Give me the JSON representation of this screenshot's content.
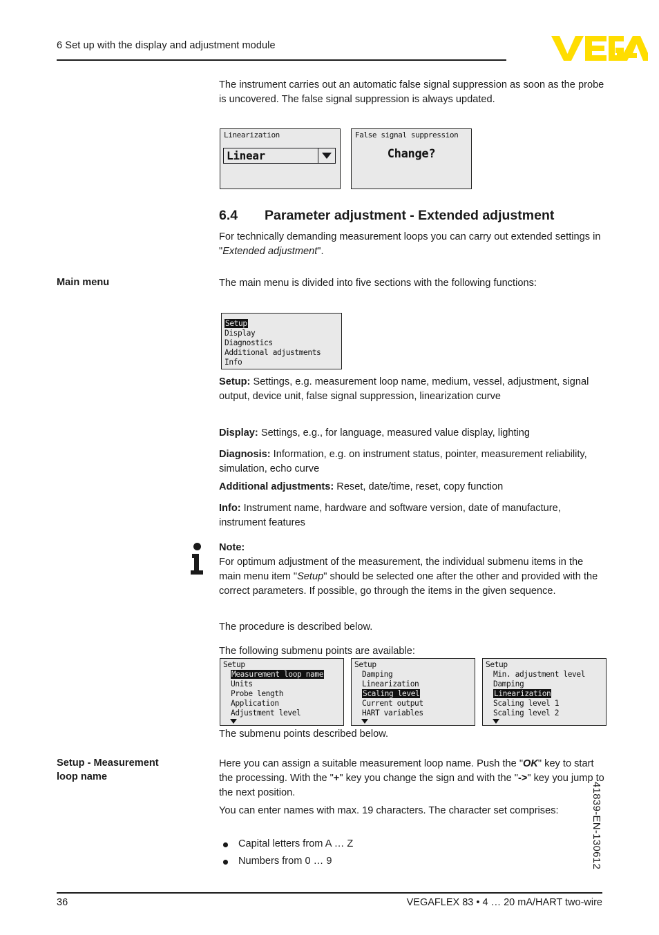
{
  "header": {
    "chapter_title": "6 Set up with the display and adjustment module",
    "logo_text": "VEGA",
    "logo_color": "#FFDD00"
  },
  "intro": {
    "paragraph": "The instrument carries out an automatic false signal suppression as soon as the probe is uncovered. The false signal suppression is always updated."
  },
  "lcd_top": [
    {
      "title": "Linearization",
      "field_value": "Linear",
      "dropdown_icon": "chevron-down-icon"
    },
    {
      "title": "False signal suppression",
      "center_text": "Change?"
    }
  ],
  "section": {
    "number": "6.4",
    "title": "Parameter adjustment - Extended adjustment",
    "intro_before": "For technically demanding measurement loops you can carry out extended settings in \"",
    "intro_italic": "Extended adjustment",
    "intro_after": "\"."
  },
  "main_menu": {
    "margin_label": "Main menu",
    "lead_in": "The main menu is divided into five sections with the following functions:",
    "lcd": {
      "items": [
        {
          "label": "Setup",
          "highlighted": true
        },
        {
          "label": "Display",
          "highlighted": false
        },
        {
          "label": "Diagnostics",
          "highlighted": false
        },
        {
          "label": "Additional adjustments",
          "highlighted": false
        },
        {
          "label": "Info",
          "highlighted": false
        }
      ]
    },
    "descriptions": [
      {
        "term": "Setup:",
        "text": " Settings, e.g. measurement loop name, medium, vessel, adjustment, signal output, device unit, false signal suppression, linearization curve"
      },
      {
        "term": "Display:",
        "text": " Settings, e.g., for language, measured value display, lighting"
      },
      {
        "term": "Diagnosis:",
        "text": " Information, e.g. on instrument status, pointer, measurement reliability, simulation, echo curve"
      },
      {
        "term": "Additional adjustments:",
        "text": " Reset, date/time, reset, copy function"
      },
      {
        "term": "Info:",
        "text": " Instrument name, hardware and software version, date of manufacture, instrument features"
      }
    ]
  },
  "note": {
    "icon": "info-note-icon",
    "title": "Note:",
    "text_before": "For optimum adjustment of the measurement, the individual submenu items in the main menu item \"",
    "text_italic": "Setup",
    "text_after": "\" should be selected one after the other and provided with the correct parameters. If possible, go through the items in the given sequence."
  },
  "procedure": {
    "line1": "The procedure is described below.",
    "line2": "The following submenu points are available:",
    "line3": "The submenu points described below."
  },
  "lcd_submenus": [
    {
      "header": "Setup",
      "items": [
        {
          "label": "Measurement loop name",
          "highlighted": true
        },
        {
          "label": "Units",
          "highlighted": false
        },
        {
          "label": "Probe length",
          "highlighted": false
        },
        {
          "label": "Application",
          "highlighted": false
        },
        {
          "label": "Adjustment level",
          "highlighted": false
        }
      ],
      "scroll_icon": "scroll-down-arrow-icon"
    },
    {
      "header": "Setup",
      "items": [
        {
          "label": "Damping",
          "highlighted": false
        },
        {
          "label": "Linearization",
          "highlighted": false
        },
        {
          "label": "Scaling level",
          "highlighted": true
        },
        {
          "label": "Current output",
          "highlighted": false
        },
        {
          "label": "HART variables",
          "highlighted": false
        }
      ],
      "scroll_icon": "scroll-down-arrow-icon"
    },
    {
      "header": "Setup",
      "items": [
        {
          "label": "Min. adjustment level",
          "highlighted": false
        },
        {
          "label": "Damping",
          "highlighted": false
        },
        {
          "label": "Linearization",
          "highlighted": true
        },
        {
          "label": "Scaling level 1",
          "highlighted": false
        },
        {
          "label": "Scaling level 2",
          "highlighted": false
        }
      ],
      "scroll_icon": "scroll-down-arrow-icon"
    }
  ],
  "setup_loop_name": {
    "margin_label_line1": "Setup - Measurement",
    "margin_label_line2": "loop name",
    "p1_a": "Here you can assign a suitable measurement loop name. Push the \"",
    "p1_ok": "OK",
    "p1_b": "\" key to start the processing. With the \"",
    "p1_plus": "+",
    "p1_c": "\" key you change the sign and with the \"",
    "p1_arrow": "->",
    "p1_d": "\" key you jump to the next position.",
    "p2": "You can enter names with max. 19 characters. The character set comprises:",
    "bullets": [
      "Capital letters from A … Z",
      "Numbers from 0 … 9"
    ]
  },
  "side_code": "41839-EN-130612",
  "footer": {
    "page_number": "36",
    "document_line": "VEGAFLEX 83 • 4 … 20 mA/HART two-wire"
  }
}
